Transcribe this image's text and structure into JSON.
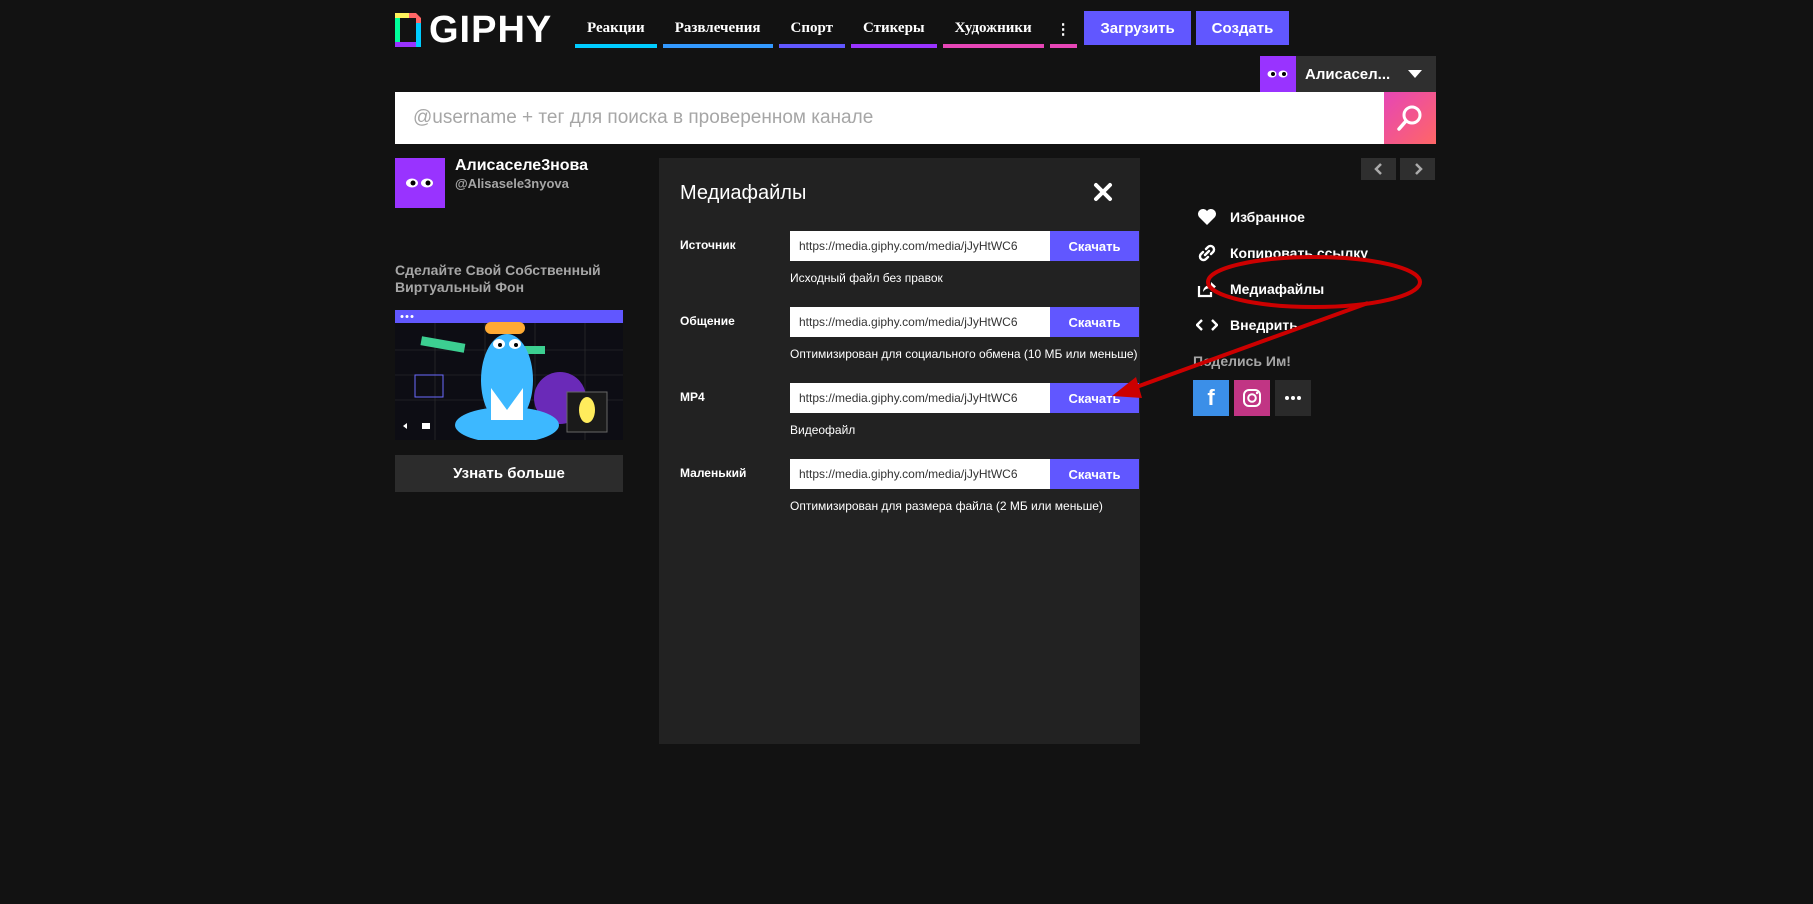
{
  "header": {
    "logo_text": "GIPHY",
    "nav": [
      {
        "label": "Реакции",
        "color": "#00ccff"
      },
      {
        "label": "Развлечения",
        "color": "#3399ff"
      },
      {
        "label": "Спорт",
        "color": "#6157ff"
      },
      {
        "label": "Стикеры",
        "color": "#9933ff"
      },
      {
        "label": "Художники",
        "color": "#e646b6"
      },
      {
        "label": "⋮",
        "color": "#e646b6"
      }
    ],
    "upload_label": "Загрузить",
    "create_label": "Создать",
    "user_name": "Алисасел..."
  },
  "search": {
    "placeholder": "@username + тег для поиска в проверенном канале"
  },
  "channel": {
    "name": "Алисаселе3нова",
    "handle": "@Alisasele3nyova"
  },
  "promo": {
    "title": "Сделайте Свой Собственный Виртуальный Фон",
    "button": "Узнать больше"
  },
  "media_panel": {
    "title": "Медиафайлы",
    "rows": [
      {
        "label": "Источник",
        "url": "https://media.giphy.com/media/jJyHtWC6",
        "button": "Скачать",
        "desc": "Исходный файл без правок"
      },
      {
        "label": "Общение",
        "url": "https://media.giphy.com/media/jJyHtWC6",
        "button": "Скачать",
        "desc": "Оптимизирован для социального обмена (10 МБ или меньше)"
      },
      {
        "label": "MP4",
        "url": "https://media.giphy.com/media/jJyHtWC6",
        "button": "Скачать",
        "desc": "Видеофайл"
      },
      {
        "label": "Маленький",
        "url": "https://media.giphy.com/media/jJyHtWC6",
        "button": "Скачать",
        "desc": "Оптимизирован для размера файла (2 МБ или меньше)"
      }
    ]
  },
  "actions": [
    {
      "label": "Избранное",
      "icon": "heart-icon"
    },
    {
      "label": "Копировать ссылку",
      "icon": "link-icon"
    },
    {
      "label": "Медиафайлы",
      "icon": "share-out-icon"
    },
    {
      "label": "Внедрить",
      "icon": "code-icon"
    }
  ],
  "share": {
    "label": "Поделись Им!",
    "items": [
      {
        "name": "facebook",
        "color": "#3b5998"
      },
      {
        "name": "instagram",
        "color": "#c13584"
      },
      {
        "name": "more",
        "color": "#2f2f2f"
      }
    ]
  },
  "annotation_color": "#cc0000"
}
